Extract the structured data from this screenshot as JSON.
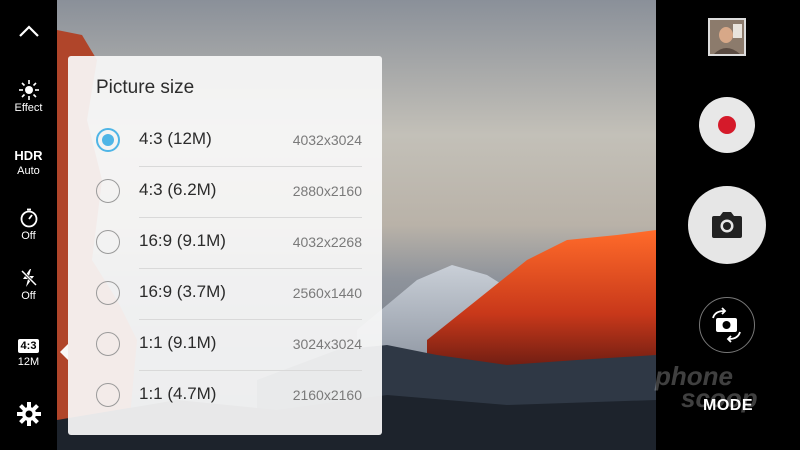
{
  "left_toolbar": {
    "effect": {
      "label": "Effect",
      "icon": "sparkle-icon"
    },
    "hdr": {
      "title": "HDR",
      "value": "Auto"
    },
    "timer": {
      "value": "Off",
      "icon": "timer-icon"
    },
    "flash": {
      "value": "Off",
      "icon": "flash-off-icon"
    },
    "picture_size": {
      "ratio": "4:3",
      "size": "12M"
    },
    "settings": {
      "icon": "gear-icon"
    }
  },
  "popup": {
    "title": "Picture size",
    "options": [
      {
        "label": "4:3 (12M)",
        "resolution": "4032x3024",
        "selected": true
      },
      {
        "label": "4:3 (6.2M)",
        "resolution": "2880x2160",
        "selected": false
      },
      {
        "label": "16:9 (9.1M)",
        "resolution": "4032x2268",
        "selected": false
      },
      {
        "label": "16:9 (3.7M)",
        "resolution": "2560x1440",
        "selected": false
      },
      {
        "label": "1:1 (9.1M)",
        "resolution": "3024x3024",
        "selected": false
      },
      {
        "label": "1:1 (4.7M)",
        "resolution": "2160x2160",
        "selected": false
      }
    ]
  },
  "right_controls": {
    "mode_label": "MODE",
    "record_color": "#d51a2a",
    "accent_color": "#4fb5e6"
  },
  "watermark": {
    "line1": "phone",
    "line2": "scoop"
  }
}
